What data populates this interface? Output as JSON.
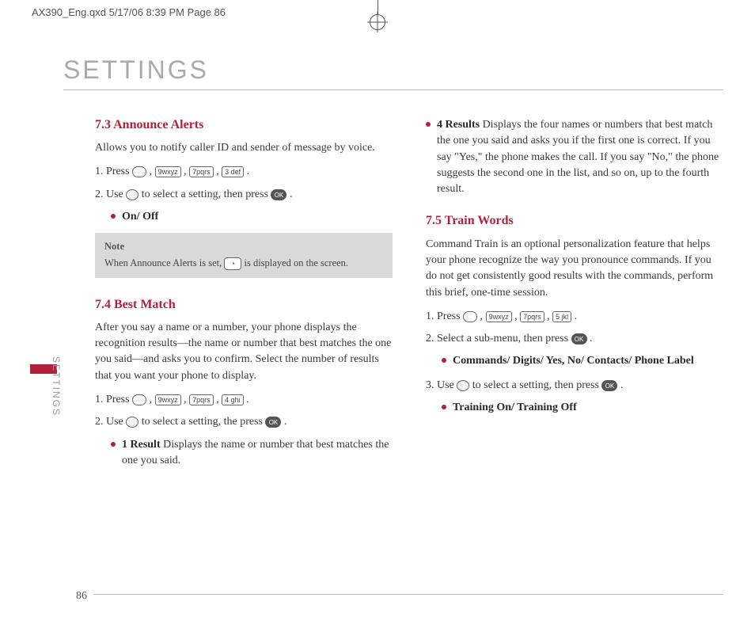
{
  "header": "AX390_Eng.qxd  5/17/06  8:39 PM  Page 86",
  "title": "SETTINGS",
  "sideTab": "SETTINGS",
  "pageNumber": "86",
  "keys": {
    "menu": "",
    "k9": "9wxyz",
    "k7": "7pqrs",
    "k3": "3 def",
    "k4": "4 ghi",
    "k5": "5 jkl",
    "nav": "",
    "ok": "OK"
  },
  "sec73": {
    "head": "7.3 Announce Alerts",
    "intro": "Allows you to notify caller ID and sender of message by voice.",
    "step1a": "1. Press ",
    "comma": " , ",
    "period": " .",
    "step2a": "2. Use ",
    "step2b": " to select a setting, then press ",
    "bullet": "On/ Off",
    "noteLabel": "Note",
    "noteA": "When Announce Alerts is set, ",
    "noteB": " is displayed on the screen."
  },
  "sec74": {
    "head": "7.4 Best Match",
    "intro": "After you say a name or a number, your phone displays the recognition results—the name or number that best matches the one you said—and asks you to confirm. Select the number of results that you want your phone to display.",
    "step1a": "1. Press ",
    "step2a": "2. Use ",
    "step2b": " to select a setting, the press ",
    "b1Label": "1 Result",
    "b1Text": " Displays the name or number that best matches the one you said.",
    "b2Label": "4 Results",
    "b2Text": " Displays the four names or numbers that best match the one you said and asks you if the first one is correct. If you say \"Yes,\" the phone makes the call. If you say \"No,\" the phone suggests the second one in the list, and so on, up to the fourth result."
  },
  "sec75": {
    "head": "7.5 Train Words",
    "intro": "Command Train is an optional personalization feature that helps your phone recognize the way you pronounce commands. If you do not get consistently good results with the commands, perform this brief, one-time session.",
    "step1a": "1. Press ",
    "step2": "2. Select a sub-menu, then press ",
    "bullet1": "Commands/ Digits/ Yes, No/ Contacts/ Phone Label",
    "step3a": "3. Use ",
    "step3b": " to select a setting, then press ",
    "bullet2": "Training On/ Training Off"
  }
}
